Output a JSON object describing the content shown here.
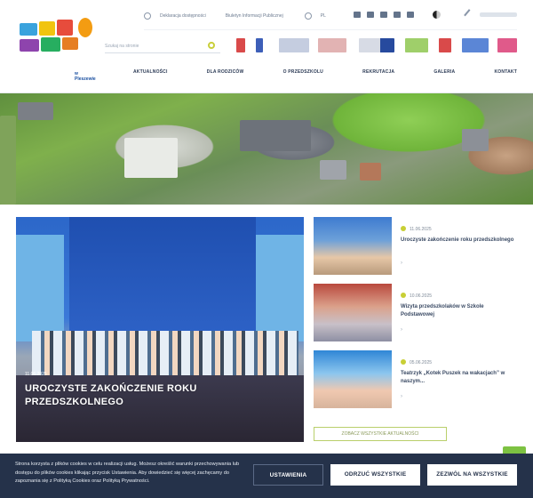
{
  "header": {
    "logo_alt": "Przedszkole",
    "logo_sub": "w Pleszewie",
    "top_links": [
      "Deklaracja dostępności",
      "Biuletyn Informacji Publicznej"
    ],
    "lang_label": "PL",
    "search_placeholder": "Szukaj na stronie"
  },
  "nav": {
    "items": [
      "AKTUALNOŚCI",
      "DLA RODZICÓW",
      "O PRZEDSZKOLU",
      "REKRUTACJA",
      "GALERIA",
      "KONTAKT"
    ]
  },
  "featured": {
    "date": "11.06.2025",
    "title": "UROCZYSTE ZAKOŃCZENIE ROKU PRZEDSZKOLNEGO"
  },
  "news": [
    {
      "date": "11.06.2025",
      "title": "Uroczyste zakończenie roku przedszkolnego",
      "more": "›"
    },
    {
      "date": "10.06.2025",
      "title": "Wizyta przedszkolaków w Szkole Podstawowej",
      "more": "›"
    },
    {
      "date": "05.06.2025",
      "title": "Teatrzyk „Kotek Puszek na wakacjach” w naszym...",
      "more": "›"
    }
  ],
  "all_news_label": "ZOBACZ WSZYSTKIE AKTUALNOŚCI",
  "cookie": {
    "text": "Strona korzysta z plików cookies w celu realizacji usług. Możesz określić warunki przechowywania lub dostępu do plików cookies klikając przycisk Ustawienia. Aby dowiedzieć się więcej zachęcamy do zapoznania się z Polityką Cookies oraz Polityką Prywatności.",
    "settings_label": "USTAWIENIA",
    "reject_label": "ODRZUĆ WSZYSTKIE",
    "accept_label": "ZEZWÓL NA WSZYSTKIE"
  },
  "colors": {
    "accent": "#c8cf35",
    "cookie_bg": "#25324a",
    "nav_text": "#2b3a55"
  }
}
